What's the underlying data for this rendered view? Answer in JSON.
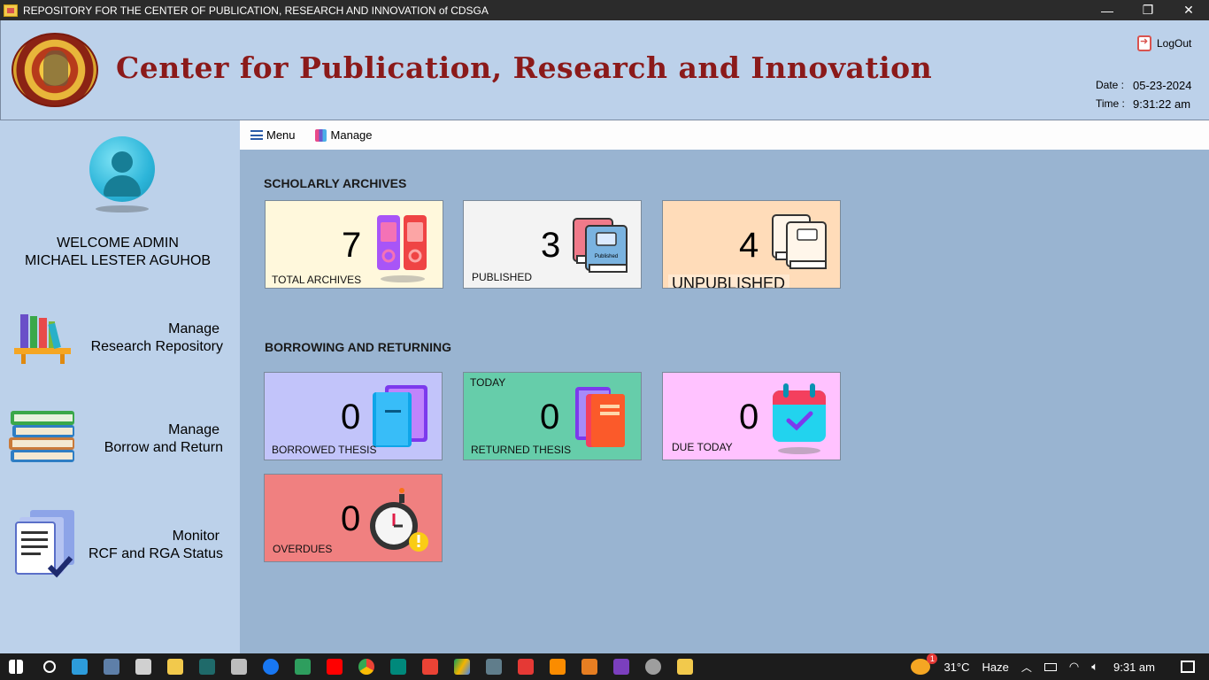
{
  "window": {
    "title": "REPOSITORY FOR THE CENTER OF PUBLICATION, RESEARCH AND INNOVATION of CDSGA",
    "minimize": "—",
    "restore": "❐",
    "close": "✕"
  },
  "header": {
    "brand_title": "Center for Publication, Research and Innovation",
    "logout_label": "LogOut",
    "date_label": "Date :",
    "date_value": "05-23-2024",
    "time_label": "Time :",
    "time_value": "9:31:22 am"
  },
  "sidebar": {
    "welcome_line1": "WELCOME ADMIN",
    "welcome_line2": "MICHAEL LESTER AGUHOB",
    "items": [
      {
        "line1": "Manage",
        "line2": "Research Repository",
        "icon": "bookshelf-icon"
      },
      {
        "line1": "Manage",
        "line2": "Borrow and Return",
        "icon": "book-stack-icon"
      },
      {
        "line1": "Monitor",
        "line2": "RCF and RGA Status",
        "icon": "document-check-icon"
      }
    ]
  },
  "toolbar": {
    "menu_label": "Menu",
    "manage_label": "Manage"
  },
  "scholarly": {
    "title": "SCHOLARLY ARCHIVES",
    "total": {
      "count": "7",
      "label": "TOTAL ARCHIVES",
      "color": "#fff8dc"
    },
    "published": {
      "count": "3",
      "label": "PUBLISHED",
      "color": "#f3f3f3",
      "book_text": "Published"
    },
    "unpublished": {
      "count": "4",
      "label": "UNPUBLISHED",
      "color": "#ffdcb9"
    }
  },
  "borrowing": {
    "title": "BORROWING AND RETURNING",
    "borrowed": {
      "count": "0",
      "label": "BORROWED THESIS",
      "color": "#c2c4fa"
    },
    "returned": {
      "count": "0",
      "label": "RETURNED THESIS",
      "sub": "TODAY",
      "color": "#66cdaa"
    },
    "due": {
      "count": "0",
      "label": "DUE TODAY",
      "color": "#ffc2ff"
    },
    "overdues": {
      "count": "0",
      "label": "OVERDUES",
      "color": "#f08080"
    }
  },
  "taskbar": {
    "temperature": "31°C",
    "weather": "Haze",
    "weather_badge": "1",
    "clock": "9:31 am"
  }
}
